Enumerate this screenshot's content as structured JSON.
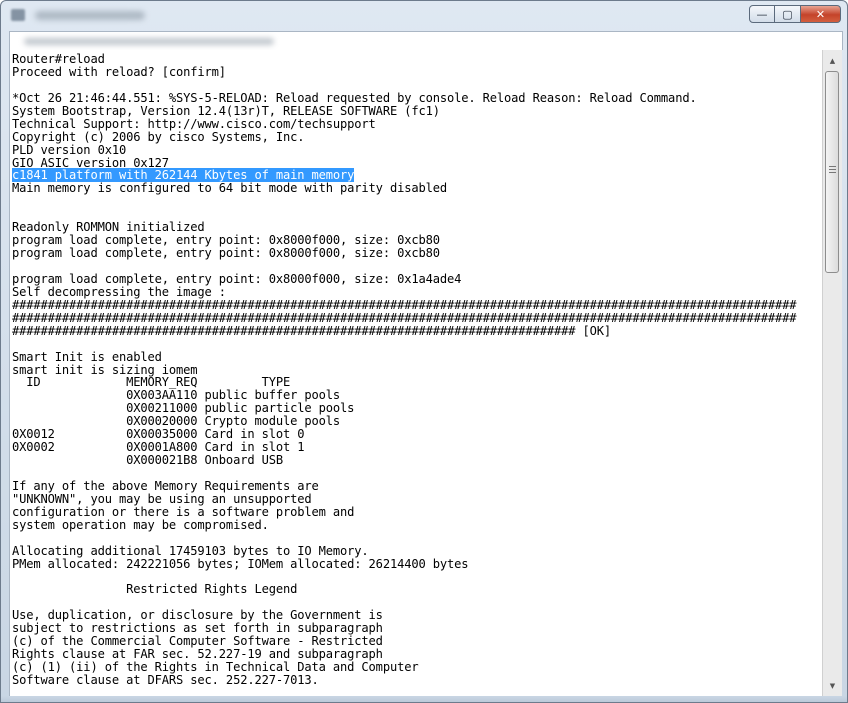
{
  "window": {
    "minimize_glyph": "—",
    "maximize_glyph": "▢",
    "close_glyph": "✕"
  },
  "terminal": {
    "lines": [
      "Router#reload",
      "Proceed with reload? [confirm]",
      "",
      "*Oct 26 21:46:44.551: %SYS-5-RELOAD: Reload requested by console. Reload Reason: Reload Command.",
      "System Bootstrap, Version 12.4(13r)T, RELEASE SOFTWARE (fc1)",
      "Technical Support: http://www.cisco.com/techsupport",
      "Copyright (c) 2006 by cisco Systems, Inc.",
      "PLD version 0x10",
      "GIO ASIC version 0x127",
      "c1841 platform with 262144 Kbytes of main memory",
      "Main memory is configured to 64 bit mode with parity disabled",
      "",
      "",
      "Readonly ROMMON initialized",
      "program load complete, entry point: 0x8000f000, size: 0xcb80",
      "program load complete, entry point: 0x8000f000, size: 0xcb80",
      "",
      "program load complete, entry point: 0x8000f000, size: 0x1a4ade4",
      "Self decompressing the image :",
      "##############################################################################################################",
      "##############################################################################################################",
      "############################################################################### [OK]",
      "",
      "Smart Init is enabled",
      "smart init is sizing iomem",
      "  ID            MEMORY_REQ         TYPE",
      "                0X003AA110 public buffer pools",
      "                0X00211000 public particle pools",
      "                0X00020000 Crypto module pools",
      "0X0012          0X00035000 Card in slot 0",
      "0X0002          0X0001A800 Card in slot 1",
      "                0X000021B8 Onboard USB",
      "",
      "If any of the above Memory Requirements are",
      "\"UNKNOWN\", you may be using an unsupported",
      "configuration or there is a software problem and",
      "system operation may be compromised.",
      "",
      "Allocating additional 17459103 bytes to IO Memory.",
      "PMem allocated: 242221056 bytes; IOMem allocated: 26214400 bytes",
      "",
      "                Restricted Rights Legend",
      "",
      "Use, duplication, or disclosure by the Government is",
      "subject to restrictions as set forth in subparagraph",
      "(c) of the Commercial Computer Software - Restricted",
      "Rights clause at FAR sec. 52.227-19 and subparagraph",
      "(c) (1) (ii) of the Rights in Technical Data and Computer",
      "Software clause at DFARS sec. 252.227-7013."
    ],
    "selected_line_index": 9
  },
  "scrollbar": {
    "up_glyph": "▲",
    "down_glyph": "▼",
    "position_fraction": 0.0
  }
}
